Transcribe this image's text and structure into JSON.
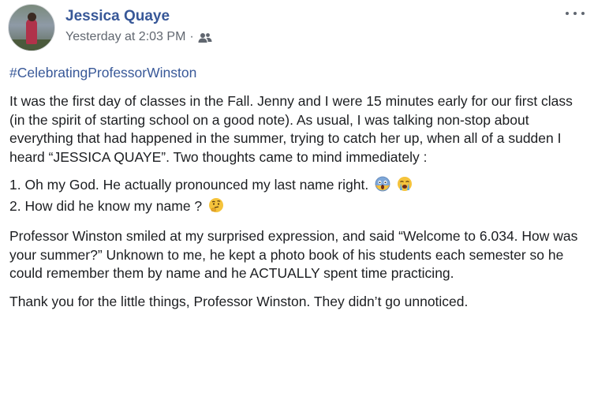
{
  "post": {
    "author": "Jessica Quaye",
    "timestamp": "Yesterday at 2:03 PM",
    "separator": "·",
    "audience_icon": "friends-icon",
    "more_icon": "more-options-icon",
    "hashtag": "#CelebratingProfessorWinston",
    "paragraphs": {
      "p1": "It was the first day of classes in the Fall. Jenny and I were 15 minutes early for our first class (in the spirit of starting school on a good note). As usual, I was talking non-stop about everything that had happened in the summer, trying to catch her up, when all of a sudden I heard “JESSICA QUAYE”. Two thoughts came to mind immediately :",
      "list1": "1. Oh my God. He actually pronounced my last name right.",
      "list2": "2. How did he know my name ?",
      "p2": "Professor Winston smiled at my surprised expression, and said “Welcome to 6.034. How was your summer?” Unknown to me, he kept a photo book of his students each semester so he could remember them by name and he ACTUALLY spent time practicing.",
      "p3": "Thank you for the little things, Professor Winston. They didn’t go unnoticed."
    },
    "emojis": {
      "list1": [
        "face-screaming-in-fear-emoji",
        "loudly-crying-face-emoji"
      ],
      "list2": [
        "thinking-face-emoji"
      ]
    },
    "colors": {
      "link": "#385898",
      "text": "#1c1e21",
      "meta": "#616770"
    }
  }
}
